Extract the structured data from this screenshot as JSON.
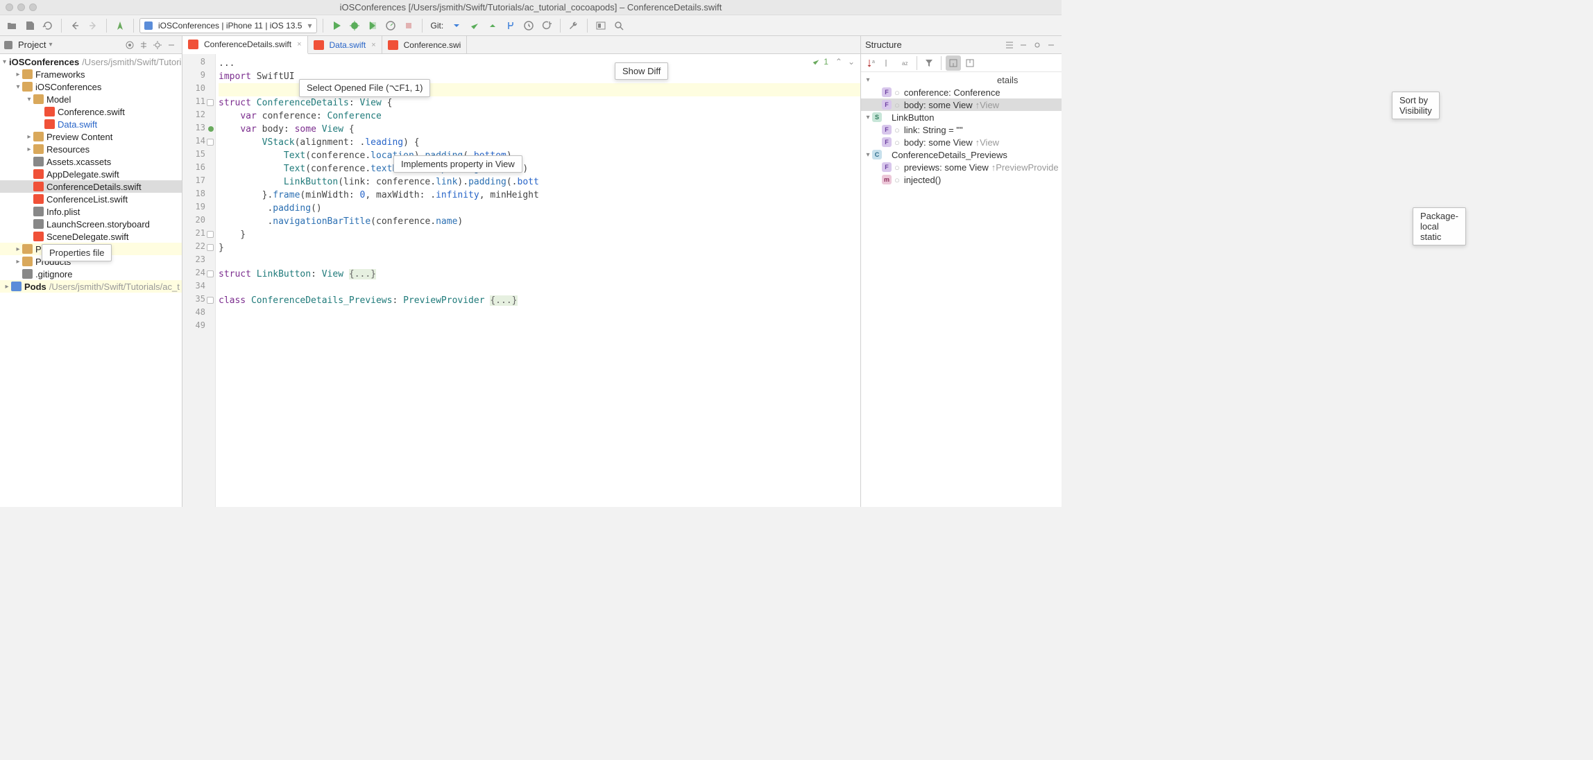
{
  "window_title": "iOSConferences [/Users/jsmith/Swift/Tutorials/ac_tutorial_cocoapods] – ConferenceDetails.swift",
  "run_config": "iOSConferences | iPhone 11 | iOS 13.5",
  "git_label": "Git:",
  "tooltips": {
    "show_diff": "Show Diff",
    "select_opened": "Select Opened File (⌥F1, 1)",
    "implements": "Implements property in View",
    "properties_file": "Properties file",
    "sort_visibility": "Sort by Visibility",
    "pkg_local": "Package-local static"
  },
  "project": {
    "label": "Project",
    "root": "iOSConferences",
    "root_path": "/Users/jsmith/Swift/Tutorials/ac_t",
    "items": [
      "Frameworks",
      "iOSConferences",
      "Model",
      "Conference.swift",
      "Data.swift",
      "Preview Content",
      "Resources",
      "Assets.xcassets",
      "AppDelegate.swift",
      "ConferenceDetails.swift",
      "ConferenceList.swift",
      "Info.plist",
      "LaunchScreen.storyboard",
      "SceneDelegate.swift",
      "Pods",
      "Products",
      ".gitignore",
      "Pods",
      "/Users/jsmith/Swift/Tutorials/ac_t"
    ]
  },
  "tabs": [
    "ConferenceDetails.swift",
    "Data.swift",
    "Conference.swi"
  ],
  "editor": {
    "inspection_count": "1",
    "lines": [
      {
        "n": 8,
        "t": ""
      },
      {
        "n": 9,
        "t": "import SwiftUI"
      },
      {
        "n": 10,
        "t": ""
      },
      {
        "n": 11,
        "t": "struct ConferenceDetails: View {"
      },
      {
        "n": 12,
        "t": "    var conference: Conference"
      },
      {
        "n": 13,
        "t": "    var body: some View {"
      },
      {
        "n": 14,
        "t": "        VStack(alignment: .leading) {"
      },
      {
        "n": 15,
        "t": "            Text(conference.location).padding(.bottom)"
      },
      {
        "n": 16,
        "t": "            Text(conference.textDates()).padding(.bottom)"
      },
      {
        "n": 17,
        "t": "            LinkButton(link: conference.link).padding(.bott"
      },
      {
        "n": 18,
        "t": "        }.frame(minWidth: 0, maxWidth: .infinity, minHeight"
      },
      {
        "n": 19,
        "t": "         .padding()"
      },
      {
        "n": 20,
        "t": "         .navigationBarTitle(conference.name)"
      },
      {
        "n": 21,
        "t": "    }"
      },
      {
        "n": 22,
        "t": "}"
      },
      {
        "n": 23,
        "t": ""
      },
      {
        "n": 24,
        "t": "struct LinkButton: View {...}"
      },
      {
        "n": 34,
        "t": ""
      },
      {
        "n": 35,
        "t": "class ConferenceDetails_Previews: PreviewProvider {...}"
      },
      {
        "n": 48,
        "t": ""
      },
      {
        "n": 49,
        "t": ""
      }
    ]
  },
  "structure": {
    "title": "Structure",
    "items": [
      {
        "label": "ConferenceDetails",
        "suffix": "etails"
      },
      {
        "label": "conference: Conference"
      },
      {
        "label": "body: some View",
        "anno": "↑View"
      },
      {
        "label": "LinkButton"
      },
      {
        "label": "link: String = \"\""
      },
      {
        "label": "body: some View",
        "anno": "↑View"
      },
      {
        "label": "ConferenceDetails_Previews"
      },
      {
        "label": "previews: some View",
        "anno": "↑PreviewProvide"
      },
      {
        "label": "injected()"
      }
    ]
  }
}
